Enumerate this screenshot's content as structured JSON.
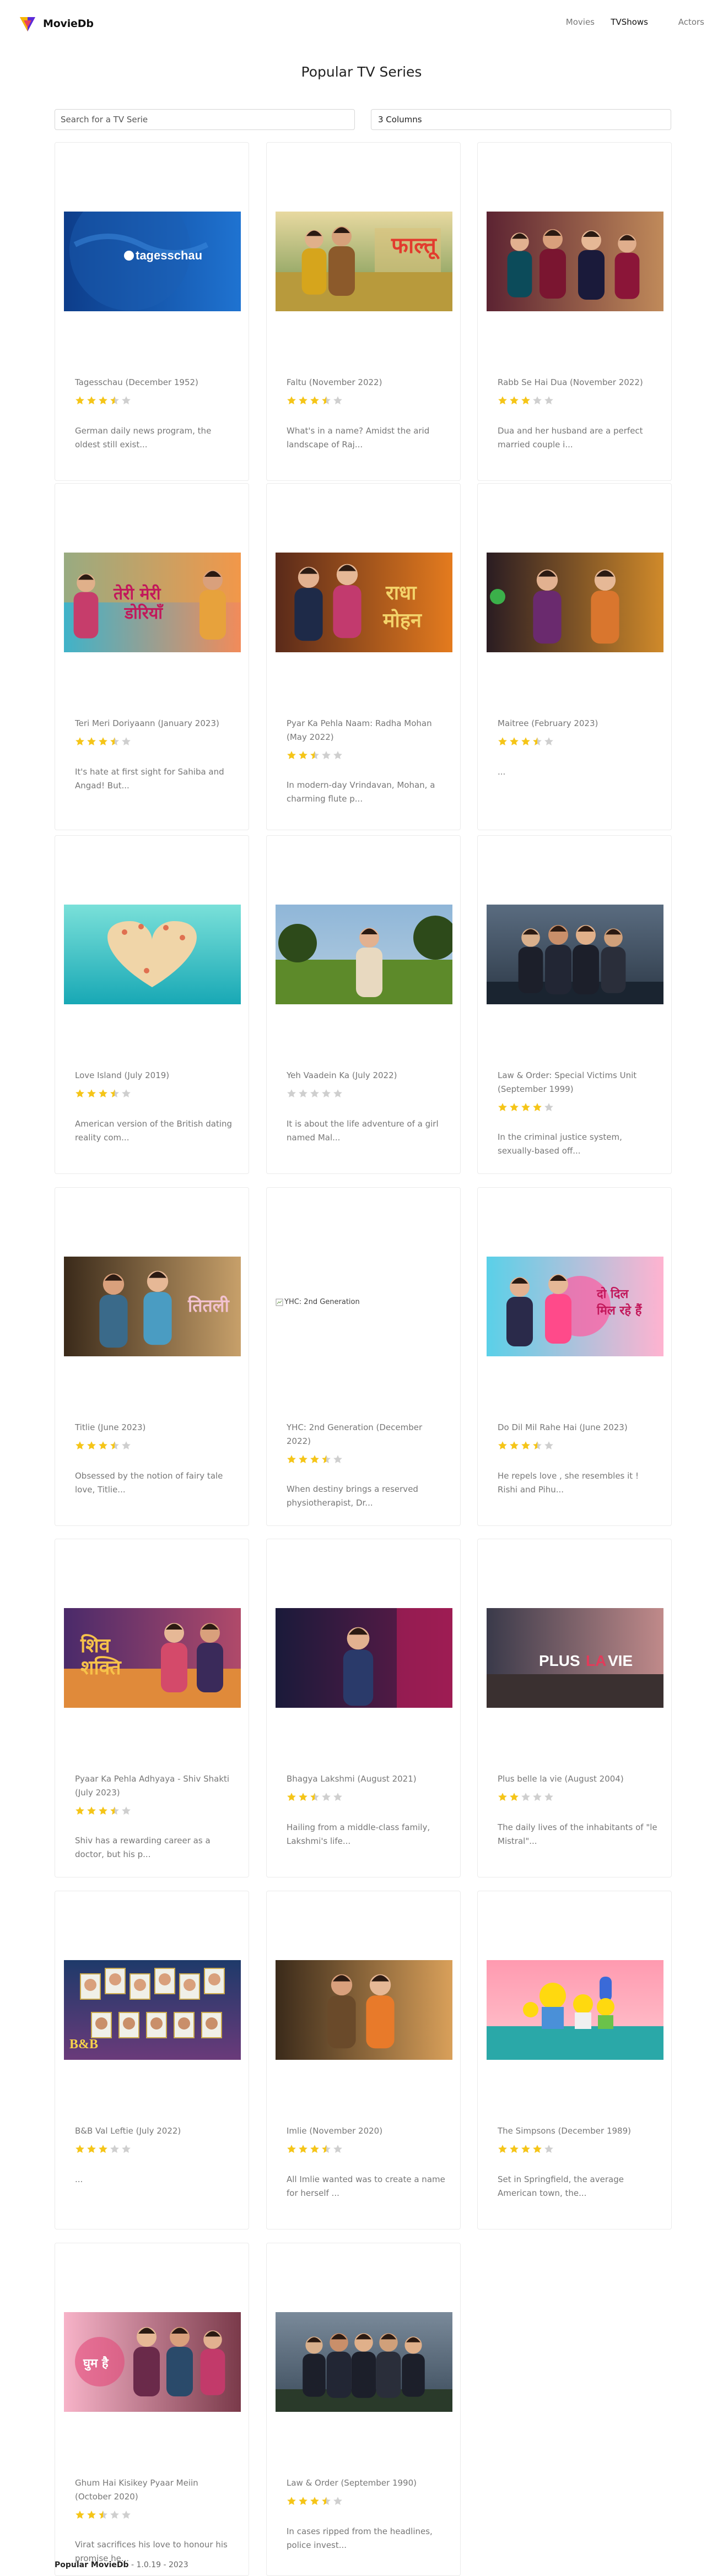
{
  "nav": {
    "brand": "MovieDb",
    "links": [
      "Movies",
      "TVShows",
      "Actors"
    ]
  },
  "page": {
    "title": "Popular TV Series",
    "search_placeholder": "Search for a TV Serie",
    "columns_value": "3 Columns"
  },
  "colors": {
    "star_filled": "#f5c518",
    "star_empty": "#cfcfcf",
    "border": "#ebebeb"
  },
  "cards": [
    {
      "title": "Tagesschau (December 1952)",
      "rating": 3.5,
      "description": "German daily news program, the oldest still exist...",
      "image": "tagesschau-poster"
    },
    {
      "title": "Faltu (November 2022)",
      "rating": 3.5,
      "description": "What's in a name? Amidst the arid landscape of Raj...",
      "image": "faltu-poster"
    },
    {
      "title": "Rabb Se Hai Dua (November 2022)",
      "rating": 3,
      "description": "Dua and her husband are a perfect married couple i...",
      "image": "rabb-se-hai-dua-poster"
    },
    {
      "title": "Teri Meri Doriyaann (January 2023)",
      "rating": 3.5,
      "description": "It's hate at first sight for Sahiba and Angad! But...",
      "image": "teri-meri-doriyaann-poster"
    },
    {
      "title": "Pyar Ka Pehla Naam: Radha Mohan (May 2022)",
      "rating": 2.5,
      "description": "In modern-day Vrindavan, Mohan, a charming flute p...",
      "image": "radha-mohan-poster"
    },
    {
      "title": "Maitree (February 2023)",
      "rating": 3.5,
      "description": "...",
      "image": "maitree-poster"
    },
    {
      "title": "Love Island (July 2019)",
      "rating": 3.5,
      "description": "American version of the British dating reality com...",
      "image": "love-island-poster"
    },
    {
      "title": "Yeh Vaadein Ka (July 2022)",
      "rating": 0,
      "description": "It is about the life adventure of a girl named Mal...",
      "image": "yeh-vaadein-ka-poster"
    },
    {
      "title": "Law & Order: Special Victims Unit (September 1999)",
      "rating": 4,
      "description": "In the criminal justice system, sexually-based off...",
      "image": "law-order-svu-poster"
    },
    {
      "title": "Titlie (June 2023)",
      "rating": 3.5,
      "description": "Obsessed by the notion of fairy tale love, Titlie...",
      "image": "titlie-poster"
    },
    {
      "title": "YHC: 2nd Generation (December 2022)",
      "rating": 3.5,
      "description": "When destiny brings a reserved physiotherapist, Dr...",
      "image": "",
      "image_alt": "YHC: 2nd Generation"
    },
    {
      "title": "Do Dil Mil Rahe Hai (June 2023)",
      "rating": 3.5,
      "description": "He repels love , she resembles it ! Rishi and Pihu...",
      "image": "do-dil-mil-rahe-hai-poster"
    },
    {
      "title": "Pyaar Ka Pehla Adhyaya - Shiv Shakti (July 2023)",
      "rating": 3.5,
      "description": "Shiv has a rewarding career as a doctor, but his p...",
      "image": "shiv-shakti-poster"
    },
    {
      "title": "Bhagya Lakshmi (August 2021)",
      "rating": 2.5,
      "description": "Hailing from a middle-class family, Lakshmi's life...",
      "image": "bhagya-lakshmi-poster"
    },
    {
      "title": "Plus belle la vie (August 2004)",
      "rating": 2,
      "description": "The daily lives of the inhabitants of \"le Mistral\"...",
      "image": "plus-belle-la-vie-poster"
    },
    {
      "title": "B&B Val Leftie (July 2022)",
      "rating": 3,
      "description": "...",
      "image": "bb-poster"
    },
    {
      "title": "Imlie (November 2020)",
      "rating": 3.5,
      "description": "All Imlie wanted was to create a name for herself ...",
      "image": "imlie-poster"
    },
    {
      "title": "The Simpsons (December 1989)",
      "rating": 4,
      "description": "Set in Springfield, the average American town, the...",
      "image": "simpsons-poster"
    },
    {
      "title": "Ghum Hai Kisikey Pyaar Meiin (October 2020)",
      "rating": 2.5,
      "description": "Virat sacrifices his love to honour his promise he...",
      "image": "ghum-hai-poster"
    },
    {
      "title": "Law & Order (September 1990)",
      "rating": 3.5,
      "description": "In cases ripped from the headlines, police invest...",
      "image": "law-order-poster"
    }
  ],
  "footer": {
    "name": "Popular MovieDb",
    "version": "1.0.19 - 2023"
  }
}
